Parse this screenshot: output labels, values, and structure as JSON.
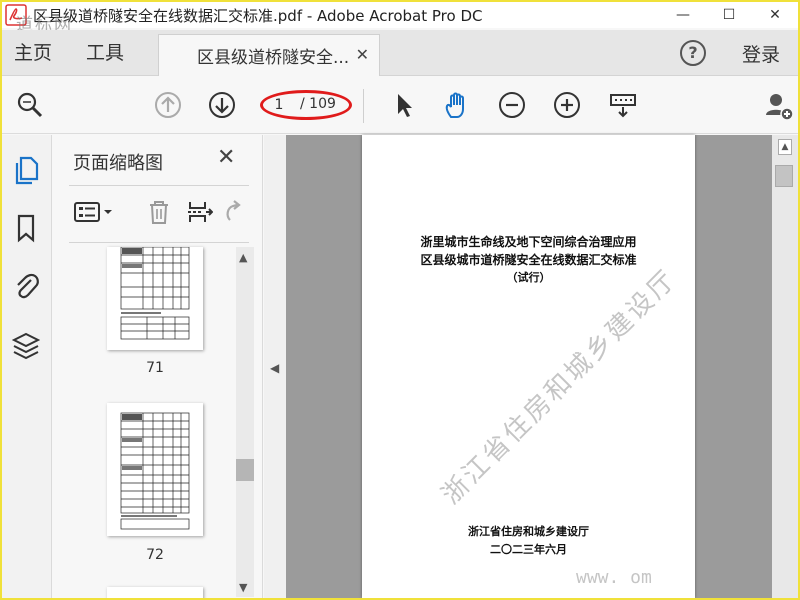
{
  "window": {
    "title": "区县级道桥隧安全在线数据汇交标准.pdf - Adobe Acrobat Pro DC",
    "minimize": "—",
    "maximize": "☐",
    "close": "✕"
  },
  "tabs": {
    "home": "主页",
    "tools": "工具",
    "document": "区县级道桥隧安全...",
    "document_close": "✕",
    "help": "?",
    "login": "登录"
  },
  "toolbar": {
    "current_page": "1",
    "total_pages": "/ 109"
  },
  "thumbnails_panel": {
    "title": "页面缩略图",
    "close": "✕",
    "pages": [
      {
        "number": "71"
      },
      {
        "number": "72"
      }
    ]
  },
  "document": {
    "title_line1": "浙里城市生命线及地下空间综合治理应用",
    "title_line2": "区县级城市道桥隧安全在线数据汇交标准",
    "title_line3": "（试行）",
    "issuer": "浙江省住房和城乡建设厅",
    "date": "二〇二三年六月",
    "watermark": "浙江省住房和城乡建设厅",
    "watermark_url": "www.        om"
  },
  "corner_watermark": "道标网",
  "colors": {
    "accent_blue": "#1a73c8",
    "highlight_red": "#e01b1b",
    "frame_yellow": "#f0e13a"
  },
  "icons": {
    "search": "search-icon",
    "prev_page": "arrow-up-circle-icon",
    "next_page": "arrow-down-circle-icon",
    "select": "cursor-arrow-icon",
    "hand": "hand-icon",
    "zoom_out": "zoom-out-icon",
    "zoom_in": "zoom-in-icon",
    "keyboard": "keyboard-icon",
    "add_user": "add-user-icon"
  }
}
